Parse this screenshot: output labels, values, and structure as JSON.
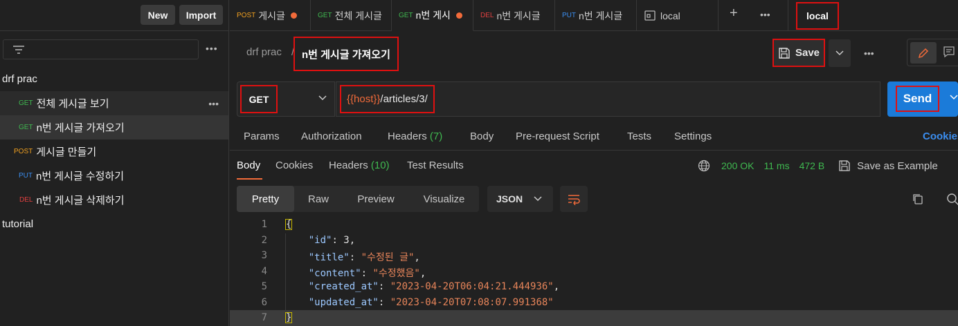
{
  "sidebar": {
    "new_label": "New",
    "import_label": "Import",
    "filter_icon": "filter-icon",
    "more": "•••",
    "collections": [
      {
        "label": "drf prac"
      },
      {
        "label": "tutorial"
      }
    ],
    "requests": [
      {
        "method": "GET",
        "label": "전체 게시글 보기"
      },
      {
        "method": "GET",
        "label": "n번 게시글 가져오기"
      },
      {
        "method": "POST",
        "label": "게시글 만들기"
      },
      {
        "method": "PUT",
        "label": "n번 게시글 수정하기"
      },
      {
        "method": "DEL",
        "label": "n번 게시글 삭제하기"
      }
    ]
  },
  "tabs": [
    {
      "method": "POST",
      "label": "게시글"
    },
    {
      "method": "GET",
      "label": "전체 게시글"
    },
    {
      "method": "GET",
      "label": "n번 게시"
    },
    {
      "method": "DEL",
      "label": "n번 게시글"
    },
    {
      "method": "PUT",
      "label": "n번 게시글"
    },
    {
      "method": "",
      "label": "local"
    }
  ],
  "tabs_add": "+",
  "tabs_more": "•••",
  "environment": "local",
  "breadcrumb": {
    "parent": "drf prac",
    "separator": "/",
    "title": "n번 게시글 가져오기"
  },
  "save_label": "Save",
  "header_more": "•••",
  "request": {
    "method": "GET",
    "url_var": "{{host}}",
    "url_path": "/articles/3/",
    "send_label": "Send"
  },
  "request_tabs": {
    "params": "Params",
    "authorization": "Authorization",
    "headers": "Headers",
    "headers_count": "(7)",
    "body": "Body",
    "prerequest": "Pre-request Script",
    "tests": "Tests",
    "settings": "Settings",
    "cookies": "Cookies"
  },
  "response_tabs": {
    "body": "Body",
    "cookies": "Cookies",
    "headers": "Headers",
    "headers_count": "(10)",
    "test_results": "Test Results"
  },
  "status": {
    "code": "200 OK",
    "time": "11 ms",
    "size": "472 B",
    "save_example": "Save as Example"
  },
  "format": {
    "pretty": "Pretty",
    "raw": "Raw",
    "preview": "Preview",
    "visualize": "Visualize",
    "language": "JSON"
  },
  "code_lines": [
    {
      "n": "1"
    },
    {
      "n": "2",
      "key": "\"id\"",
      "val": "3",
      "type": "num"
    },
    {
      "n": "3",
      "key": "\"title\"",
      "val": "\"수정된 글\"",
      "type": "str"
    },
    {
      "n": "4",
      "key": "\"content\"",
      "val": "\"수정했음\"",
      "type": "str"
    },
    {
      "n": "5",
      "key": "\"created_at\"",
      "val": "\"2023-04-20T06:04:21.444936\"",
      "type": "str"
    },
    {
      "n": "6",
      "key": "\"updated_at\"",
      "val": "\"2023-04-20T07:08:07.991368\"",
      "type": "str"
    },
    {
      "n": "7"
    }
  ],
  "brace_open": "{",
  "brace_close": "}",
  "colors": {
    "accent": "#f26b3a",
    "send": "#1b7bd9",
    "get": "#3fb950",
    "post": "#f0a020",
    "put": "#3b8ef0",
    "del": "#e04040",
    "highlight_box": "#e01010"
  }
}
